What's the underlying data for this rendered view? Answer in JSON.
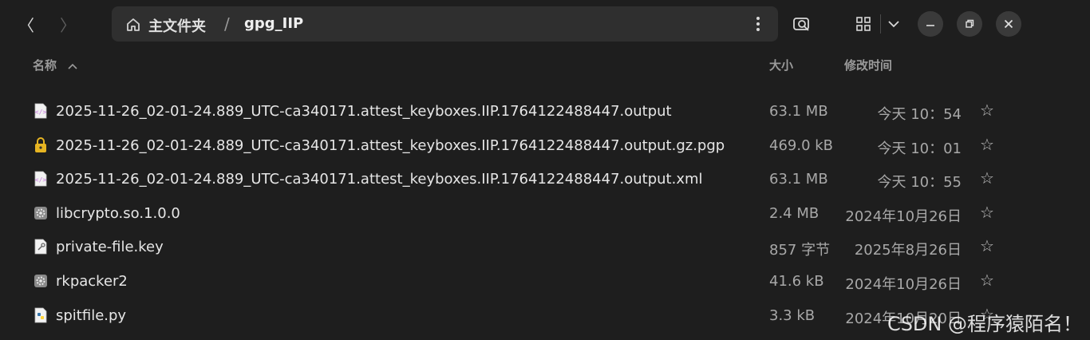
{
  "nav": {
    "back_glyph": "〈",
    "forward_glyph": "〉"
  },
  "pathbar": {
    "home_label": "主文件夹",
    "separator": "/",
    "current": "gpg_IIP"
  },
  "columns": {
    "name": "名称",
    "size": "大小",
    "modified": "修改时间"
  },
  "files": [
    {
      "name": "2025-11-26_02-01-24.889_UTC-ca340171.attest_keyboxes.IIP.1764122488447.output",
      "size": "63.1 MB",
      "modified": "今天 10：54",
      "icon": "code-file-icon",
      "color": "#c678dd"
    },
    {
      "name": "2025-11-26_02-01-24.889_UTC-ca340171.attest_keyboxes.IIP.1764122488447.output.gz.pgp",
      "size": "469.0 kB",
      "modified": "今天 10：01",
      "icon": "lock-file-icon",
      "color": "#e6b422"
    },
    {
      "name": "2025-11-26_02-01-24.889_UTC-ca340171.attest_keyboxes.IIP.1764122488447.output.xml",
      "size": "63.1 MB",
      "modified": "今天 10：55",
      "icon": "code-file-icon",
      "color": "#c678dd"
    },
    {
      "name": "libcrypto.so.1.0.0",
      "size": "2.4 MB",
      "modified": "2024年10月26日",
      "icon": "gear-file-icon",
      "color": "#9a9a9a"
    },
    {
      "name": "private-file.key",
      "size": "857 字节",
      "modified": "2025年8月26日",
      "icon": "key-file-icon",
      "color": "#cfcfcf"
    },
    {
      "name": "rkpacker2",
      "size": "41.6 kB",
      "modified": "2024年10月26日",
      "icon": "gear-file-icon",
      "color": "#9a9a9a"
    },
    {
      "name": "spitfile.py",
      "size": "3.3 kB",
      "modified": "2024年10月20日",
      "icon": "python-file-icon",
      "color": "#3776ab"
    }
  ],
  "star_glyph": "☆",
  "watermark": "CSDN @程序猿陌名！"
}
